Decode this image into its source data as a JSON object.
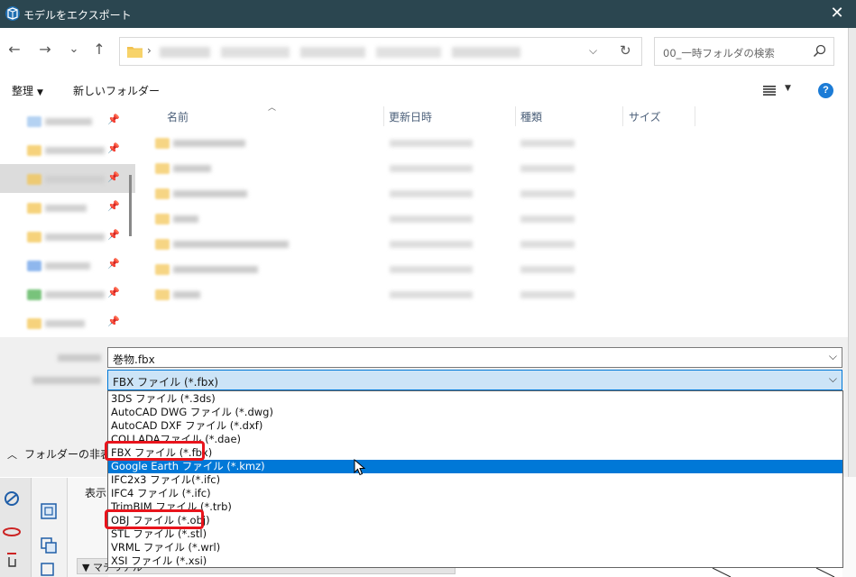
{
  "window": {
    "title": "モデルをエクスポート",
    "close_label": "✕"
  },
  "nav": {
    "back": "←",
    "forward": "→",
    "recent": "⌄",
    "up": "↑",
    "address_separator": "›",
    "search_placeholder": "00_一時フォルダの検索"
  },
  "toolbar": {
    "organize": "整理",
    "new_folder": "新しいフォルダー"
  },
  "file_list": {
    "columns": [
      "名前",
      "更新日時",
      "種類",
      "サイズ"
    ]
  },
  "form": {
    "filename_value": "巻物.fbx",
    "filetype_value": "FBX ファイル (*.fbx)",
    "hide_folders_label": "フォルダーの非表示"
  },
  "filetype_options": [
    "3DS ファイル (*.3ds)",
    "AutoCAD DWG ファイル (*.dwg)",
    "AutoCAD DXF ファイル (*.dxf)",
    "COLLADAファイル (*.dae)",
    "FBX ファイル (*.fbx)",
    "Google Earth ファイル (*.kmz)",
    "IFC2x3 ファイル(*.ifc)",
    "IFC4 ファイル (*.ifc)",
    "TrimBIM ファイル (*.trb)",
    "OBJ ファイル (*.obj)",
    "STL ファイル (*.stl)",
    "VRML ファイル (*.wrl)",
    "XSI ファイル (*.xsi)"
  ],
  "highlighted_option_index": 5,
  "annotated_option_indices": [
    4,
    9
  ],
  "background_app": {
    "panel_label": "表示",
    "strip_label": "▼ マテリアル"
  },
  "colors": {
    "title_bar": "#2b4650",
    "selection": "#0078d7",
    "annotation": "#e8141c",
    "accent": "#1c7cd6"
  }
}
